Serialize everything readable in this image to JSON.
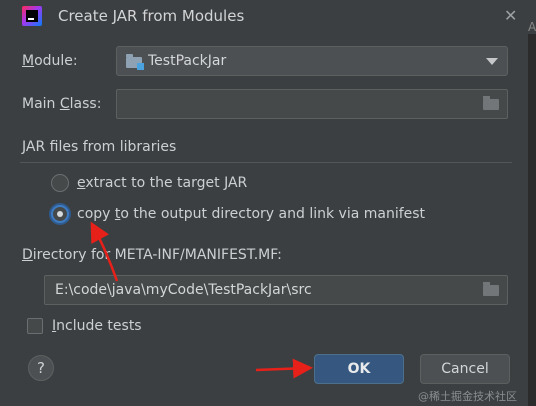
{
  "window": {
    "title": "Create JAR from Modules",
    "close_glyph": "✕",
    "edge_glyph": "A"
  },
  "module": {
    "label_underlined": "M",
    "label_rest": "odule:",
    "value": "TestPackJar",
    "icon": "module-folder-icon"
  },
  "main_class": {
    "label_start": "Main ",
    "label_underlined": "C",
    "label_rest": "lass:",
    "value": "",
    "browse_icon": "folder-icon"
  },
  "libraries": {
    "section_title": "JAR files from libraries",
    "options": [
      {
        "label_underlined": "e",
        "label_rest": "xtract to the target JAR",
        "selected": false
      },
      {
        "label_start": "copy ",
        "label_underlined": "t",
        "label_rest": "o the output directory and link via manifest",
        "selected": true
      }
    ]
  },
  "manifest": {
    "label_underlined": "D",
    "label_rest": "irectory for META-INF/MANIFEST.MF:",
    "value": "E:\\code\\java\\myCode\\TestPackJar\\src",
    "browse_icon": "folder-icon"
  },
  "include_tests": {
    "label_underlined": "I",
    "label_rest": "nclude tests",
    "checked": false
  },
  "buttons": {
    "help": "?",
    "ok": "OK",
    "cancel": "Cancel"
  },
  "annotations": {
    "arrow_color": "#e8201a"
  },
  "watermark": "@稀土掘金技术社区",
  "colors": {
    "background": "#3c3f41",
    "accent": "#365880",
    "text": "#cdd0d3"
  }
}
